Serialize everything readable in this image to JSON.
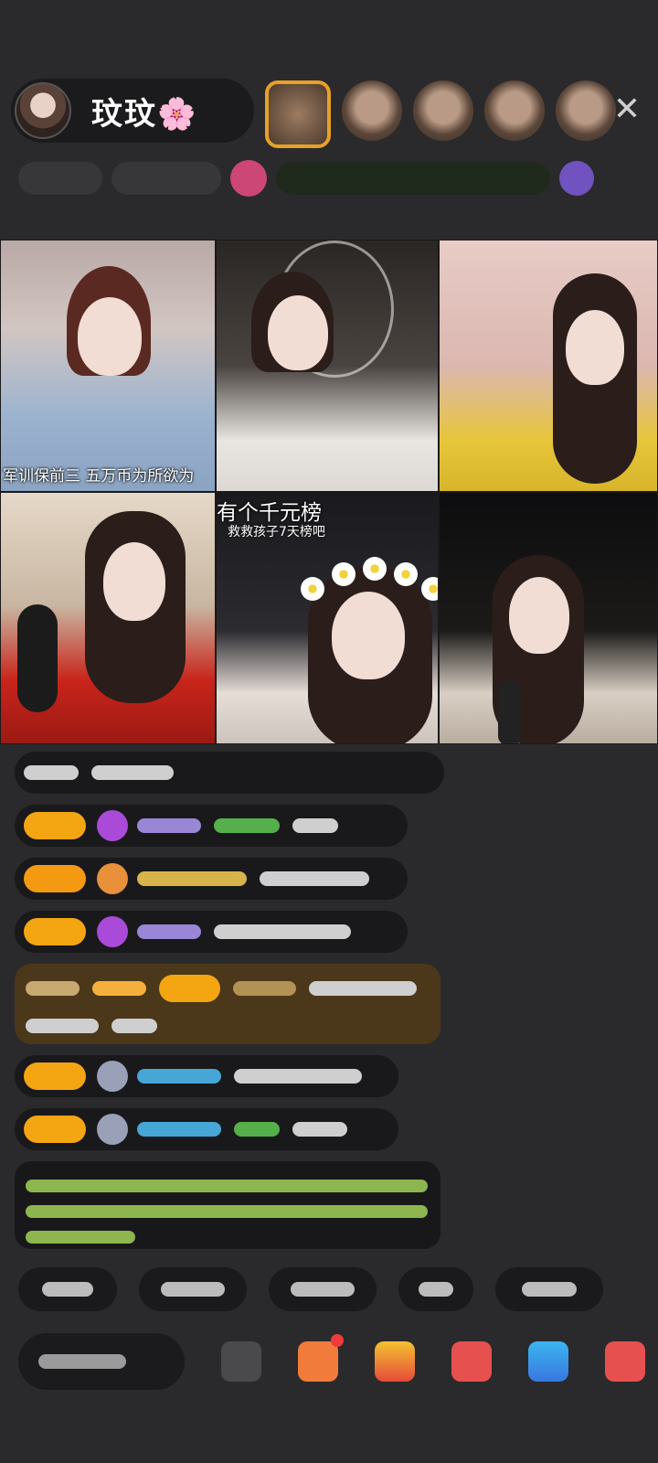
{
  "header": {
    "host_name": "玟玟🌸",
    "close_icon": "close-icon"
  },
  "video_grid": {
    "tile1_caption": "军训保前三   五万币为所欲为",
    "tile5_caption": "有个千元榜",
    "tile5_subcaption": "救救孩子7天榜吧"
  },
  "colors": {
    "accent_orange": "#f4a512",
    "background": "#2a2a2c",
    "chat_highlight": "#4b3719"
  }
}
